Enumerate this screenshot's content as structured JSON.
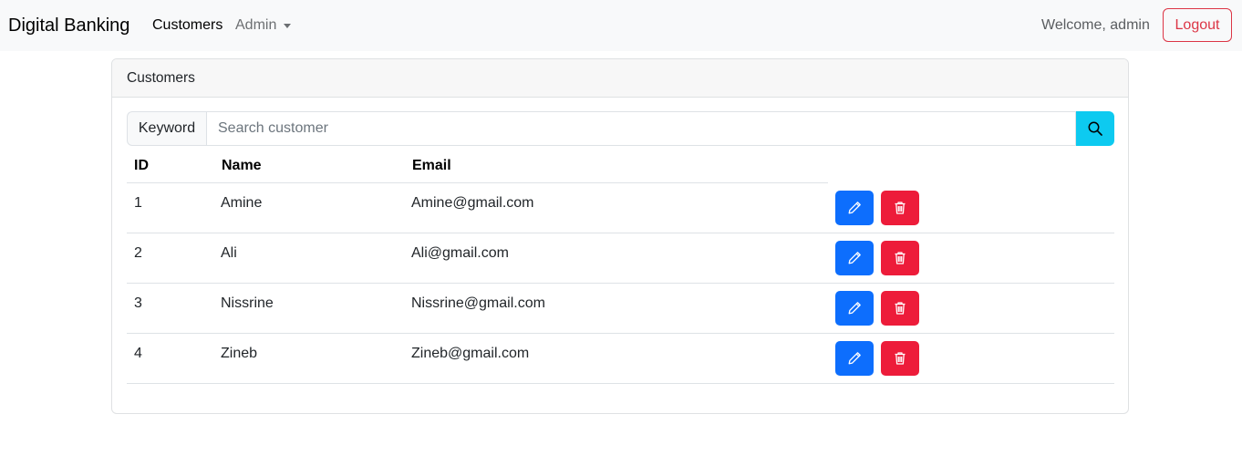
{
  "navbar": {
    "brand": "Digital Banking",
    "links": [
      {
        "label": "Customers"
      },
      {
        "label": "Admin"
      }
    ],
    "welcome": "Welcome, admin",
    "logout_label": "Logout"
  },
  "card": {
    "header": "Customers",
    "search": {
      "label": "Keyword",
      "placeholder": "Search customer",
      "value": "",
      "button_icon": "search-icon"
    },
    "table": {
      "columns": [
        "ID",
        "Name",
        "Email"
      ],
      "rows": [
        {
          "id": "1",
          "name": "Amine",
          "email": "Amine@gmail.com"
        },
        {
          "id": "2",
          "name": "Ali",
          "email": "Ali@gmail.com"
        },
        {
          "id": "3",
          "name": "Nissrine",
          "email": "Nissrine@gmail.com"
        },
        {
          "id": "4",
          "name": "Zineb",
          "email": "Zineb@gmail.com"
        }
      ],
      "row_actions": [
        "pencil-icon",
        "trash-icon"
      ]
    }
  },
  "colors": {
    "edit_button": "#0d6efd",
    "delete_button": "#ed1c3a",
    "search_button": "#0dcaf0",
    "logout": "#dc3545"
  }
}
